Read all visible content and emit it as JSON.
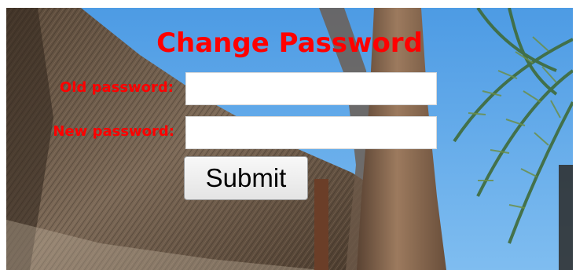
{
  "form": {
    "title": "Change Password",
    "old_password_label": "Old password:",
    "old_password_value": "",
    "new_password_label": "New password:",
    "new_password_value": "",
    "submit_label": "Submit"
  },
  "colors": {
    "label_color": "#ff0000",
    "sky": "#5aa3e6"
  }
}
